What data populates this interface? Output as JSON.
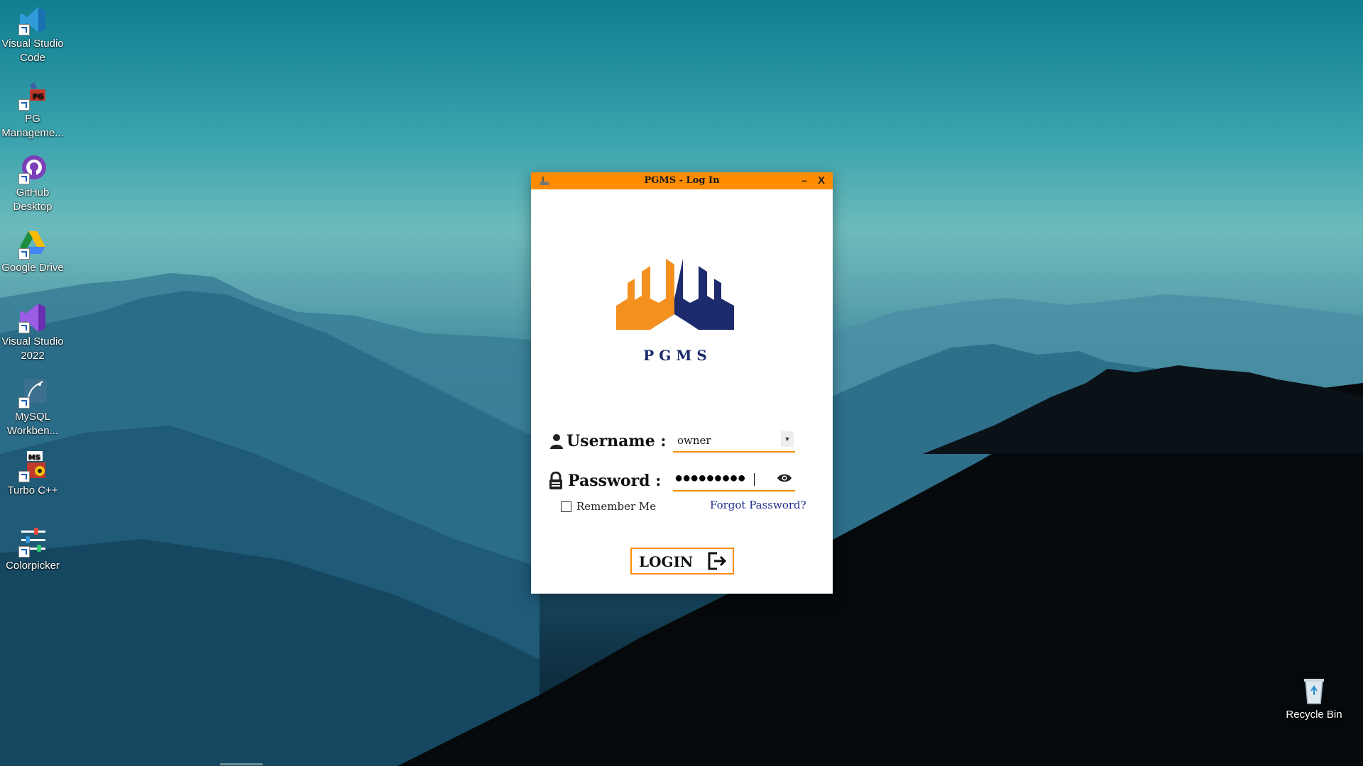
{
  "desktop": {
    "icons": [
      {
        "label": "Visual Studio Code",
        "icon": "vscode-icon"
      },
      {
        "label": "PG Manageme...",
        "icon": "pg-management-icon"
      },
      {
        "label": "GitHub Desktop",
        "icon": "github-desktop-icon"
      },
      {
        "label": "Google Drive",
        "icon": "google-drive-icon"
      },
      {
        "label": "Visual Studio 2022",
        "icon": "visual-studio-icon"
      },
      {
        "label": "MySQL Workben...",
        "icon": "mysql-workbench-icon"
      },
      {
        "label": "Turbo C++",
        "icon": "turbo-cpp-icon"
      },
      {
        "label": "Colorpicker",
        "icon": "colorpicker-icon"
      }
    ],
    "recycle_bin": {
      "label": "Recycle Bin",
      "icon": "recycle-bin-icon"
    }
  },
  "login_window": {
    "title": "PGMS - Log In",
    "minimize": "–",
    "close": "X",
    "logo_text": "P G M S",
    "username_label": "Username :",
    "username_value": "owner",
    "password_label": "Password :",
    "password_mask": "●●●●●●●●●",
    "remember_label": "Remember Me",
    "remember_checked": false,
    "forgot_label": "Forgot Password?",
    "login_label": "LOGIN"
  },
  "colors": {
    "accent": "#ff8c00",
    "logo_navy": "#1c2b6b",
    "link": "#1f2d8c"
  }
}
